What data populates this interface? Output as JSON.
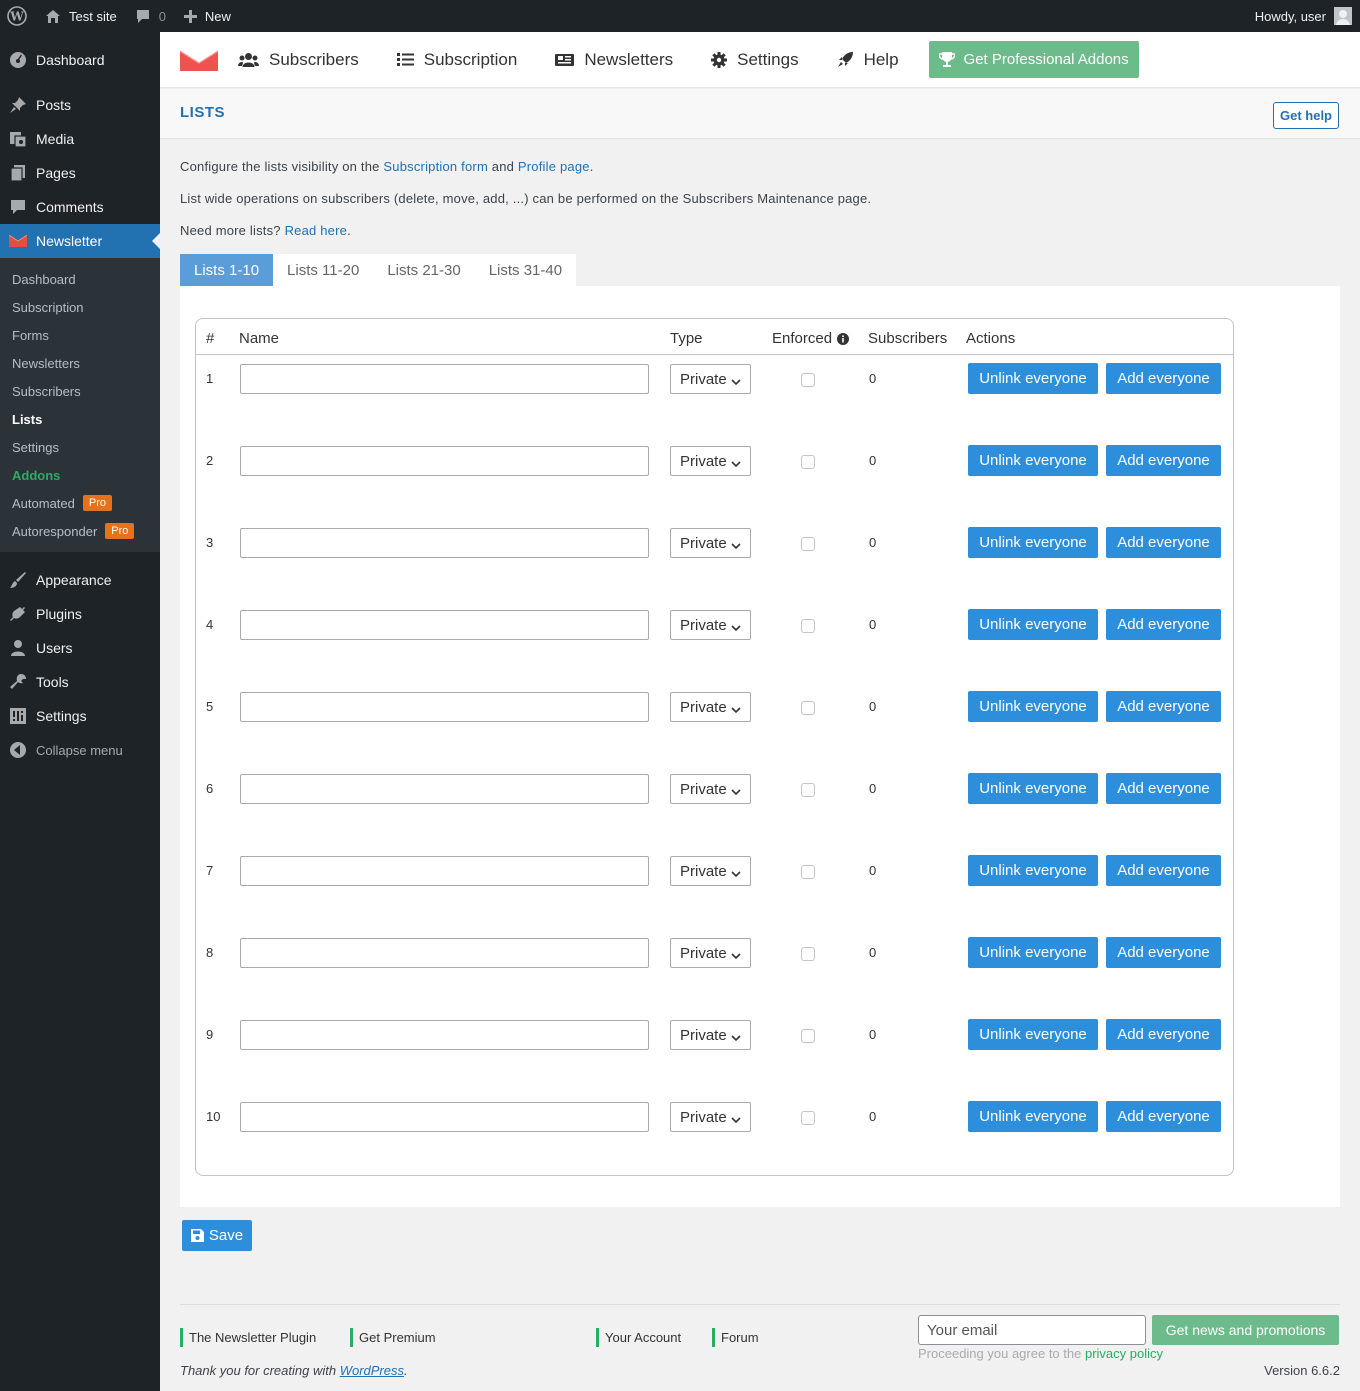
{
  "adminbar": {
    "site_name": "Test site",
    "comments_count": "0",
    "new_label": "New",
    "howdy": "Howdy, user"
  },
  "sidebar": {
    "top_items": [
      {
        "label": "Dashboard",
        "icon": "dashboard-icon"
      },
      {
        "label": "Posts",
        "icon": "pin-icon"
      },
      {
        "label": "Media",
        "icon": "media-icon"
      },
      {
        "label": "Pages",
        "icon": "pages-icon"
      },
      {
        "label": "Comments",
        "icon": "comment-icon"
      },
      {
        "label": "Newsletter",
        "icon": "newsletter-icon"
      }
    ],
    "submenu": [
      {
        "label": "Dashboard"
      },
      {
        "label": "Subscription"
      },
      {
        "label": "Forms"
      },
      {
        "label": "Newsletters"
      },
      {
        "label": "Subscribers"
      },
      {
        "label": "Lists"
      },
      {
        "label": "Settings"
      },
      {
        "label": "Addons"
      },
      {
        "label": "Automated",
        "badge": "Pro"
      },
      {
        "label": "Autoresponder",
        "badge": "Pro"
      }
    ],
    "bottom_items": [
      {
        "label": "Appearance",
        "icon": "brush-icon"
      },
      {
        "label": "Plugins",
        "icon": "plug-icon"
      },
      {
        "label": "Users",
        "icon": "user-icon"
      },
      {
        "label": "Tools",
        "icon": "wrench-icon"
      },
      {
        "label": "Settings",
        "icon": "settings-icon"
      }
    ],
    "collapse_label": "Collapse menu"
  },
  "topnav": {
    "links": [
      {
        "label": "Subscribers",
        "icon": "users-icon"
      },
      {
        "label": "Subscription",
        "icon": "list-icon"
      },
      {
        "label": "Newsletters",
        "icon": "newspaper-icon"
      },
      {
        "label": "Settings",
        "icon": "cog-icon"
      },
      {
        "label": "Help",
        "icon": "rocket-icon"
      }
    ],
    "pro_button": "Get Professional Addons",
    "accent_color": "#6dbb8a"
  },
  "header": {
    "title": "LISTS",
    "help_button": "Get help"
  },
  "intro": {
    "line1_prefix": "Configure the lists visibility on the",
    "line1_link1": "Subscription form",
    "line1_and": "and",
    "line1_link2": "Profile page",
    "line1_suffix": ".",
    "line2": "List wide operations on subscribers (delete, move, add, ...) can be performed on the Subscribers Maintenance page.",
    "line3_prefix": "Need more lists?",
    "line3_link": "Read here",
    "line3_suffix": "."
  },
  "tabs": [
    {
      "label": "Lists 1-10",
      "active": true
    },
    {
      "label": "Lists 11-20",
      "active": false
    },
    {
      "label": "Lists 21-30",
      "active": false
    },
    {
      "label": "Lists 31-40",
      "active": false
    }
  ],
  "table": {
    "headers": {
      "num": "#",
      "name": "Name",
      "type": "Type",
      "enforced": "Enforced",
      "subscribers": "Subscribers",
      "actions": "Actions"
    },
    "rows": [
      {
        "num": "1",
        "name": "",
        "type": "Private",
        "enforced": false,
        "subscribers": "0"
      },
      {
        "num": "2",
        "name": "",
        "type": "Private",
        "enforced": false,
        "subscribers": "0"
      },
      {
        "num": "3",
        "name": "",
        "type": "Private",
        "enforced": false,
        "subscribers": "0"
      },
      {
        "num": "4",
        "name": "",
        "type": "Private",
        "enforced": false,
        "subscribers": "0"
      },
      {
        "num": "5",
        "name": "",
        "type": "Private",
        "enforced": false,
        "subscribers": "0"
      },
      {
        "num": "6",
        "name": "",
        "type": "Private",
        "enforced": false,
        "subscribers": "0"
      },
      {
        "num": "7",
        "name": "",
        "type": "Private",
        "enforced": false,
        "subscribers": "0"
      },
      {
        "num": "8",
        "name": "",
        "type": "Private",
        "enforced": false,
        "subscribers": "0"
      },
      {
        "num": "9",
        "name": "",
        "type": "Private",
        "enforced": false,
        "subscribers": "0"
      },
      {
        "num": "10",
        "name": "",
        "type": "Private",
        "enforced": false,
        "subscribers": "0"
      }
    ],
    "unlink_label": "Unlink everyone",
    "add_label": "Add everyone"
  },
  "save_label": "Save",
  "footer": {
    "links": [
      "The Newsletter Plugin",
      "Get Premium",
      "Your Account",
      "Forum"
    ],
    "email_placeholder": "Your email",
    "news_button": "Get news and promotions",
    "privacy_prefix": "Proceeding you agree to the",
    "privacy_link": "privacy policy",
    "thanks_prefix": "Thank you for creating with",
    "thanks_link": "WordPress",
    "thanks_suffix": ".",
    "version": "Version 6.6.2"
  },
  "colors": {
    "primary_blue": "#2d8fdc",
    "wp_blue": "#2271b1",
    "green": "#27ae60",
    "sidebar_bg": "#1d2327"
  }
}
